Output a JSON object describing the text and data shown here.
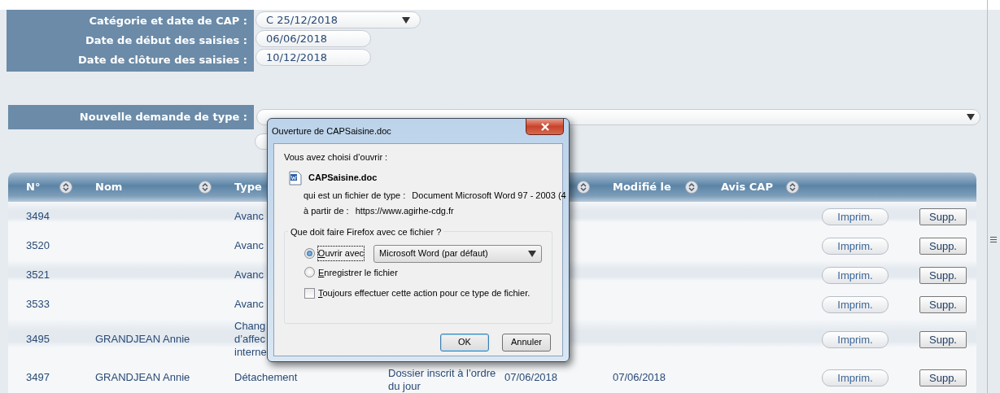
{
  "filters": [
    {
      "label": "Catégorie et date de CAP :",
      "kind": "select",
      "value": "C  25/12/2018"
    },
    {
      "label": "Date de début des saisies :",
      "kind": "input",
      "value": "06/06/2018"
    },
    {
      "label": "Date de clôture des saisies :",
      "kind": "input",
      "value": "10/12/2018"
    }
  ],
  "new_request": {
    "label": "Nouvelle demande de type :"
  },
  "table": {
    "columns": [
      {
        "label": "N°",
        "sort_icon": true
      },
      {
        "label": "Nom",
        "sort_icon": true
      },
      {
        "label": "Type"
      },
      {
        "sort_icon": true
      },
      {
        "label": "Modifié le",
        "sort_icon": true
      },
      {
        "label": "Avis CAP",
        "sort_icon": true
      }
    ],
    "rows": [
      {
        "number": "3494",
        "type_lines": [
          "Avanc"
        ],
        "print": "Imprim.",
        "delete": "Supp."
      },
      {
        "number": "3520",
        "type_lines": [
          "Avanc"
        ],
        "print": "Imprim.",
        "delete": "Supp."
      },
      {
        "number": "3521",
        "type_lines": [
          "Avanc"
        ],
        "print": "Imprim.",
        "delete": "Supp."
      },
      {
        "number": "3533",
        "type_lines": [
          "Avanc"
        ],
        "print": "Imprim.",
        "delete": "Supp."
      },
      {
        "number": "3495",
        "name": "GRANDJEAN Annie",
        "type_lines": [
          "Chang",
          "d’affec",
          "interne"
        ],
        "print": "Imprim.",
        "delete": "Supp."
      },
      {
        "number": "3497",
        "name": "GRANDJEAN Annie",
        "type_lines": [
          "Détachement"
        ],
        "status": "Dossier inscrit à l’ordre du jour",
        "date": "07/06/2018",
        "modified": "07/06/2018",
        "print": "Imprim.",
        "delete": "Supp."
      }
    ]
  },
  "dialog": {
    "title": "Ouverture de CAPSaisine.doc",
    "intro": "Vous avez choisi d’ouvrir :",
    "filename": "CAPSaisine.doc",
    "type_label": "qui est un fichier de type :",
    "type_value": "Document Microsoft Word 97 - 2003 (4",
    "from_label": "à partir de :",
    "from_value": "https://www.agirhe-cdg.fr",
    "question": "Que doit faire Firefox avec ce fichier ?",
    "options": [
      {
        "label": "Ouvrir avec",
        "selected": true,
        "app": "Microsoft Word (par défaut)"
      },
      {
        "label": "Enregistrer le fichier",
        "selected": false
      }
    ],
    "always": {
      "label": "Toujours effectuer cette action pour ce type de fichier.",
      "checked": false
    },
    "buttons": [
      "OK",
      "Annuler"
    ]
  }
}
